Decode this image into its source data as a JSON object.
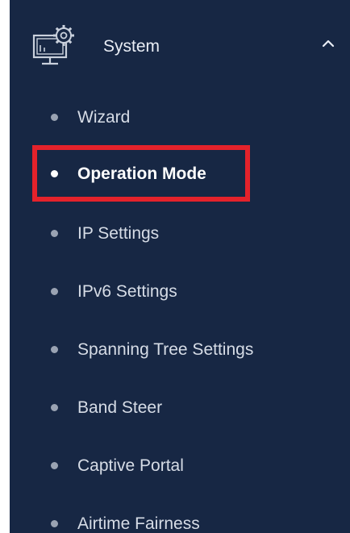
{
  "sidebar": {
    "section": {
      "label": "System",
      "icon": "system-settings-icon",
      "expanded": true,
      "chevron_icon": "chevron-up-icon"
    },
    "items": [
      {
        "label": "Wizard",
        "active": false
      },
      {
        "label": "Operation Mode",
        "active": true
      },
      {
        "label": "IP Settings",
        "active": false
      },
      {
        "label": "IPv6 Settings",
        "active": false
      },
      {
        "label": "Spanning Tree Settings",
        "active": false
      },
      {
        "label": "Band Steer",
        "active": false
      },
      {
        "label": "Captive Portal",
        "active": false
      },
      {
        "label": "Airtime Fairness",
        "active": false
      }
    ]
  },
  "colors": {
    "sidebar_background": "#172744",
    "text": "#d6dce6",
    "active_text": "#ffffff",
    "highlight_border": "#e4222b"
  }
}
